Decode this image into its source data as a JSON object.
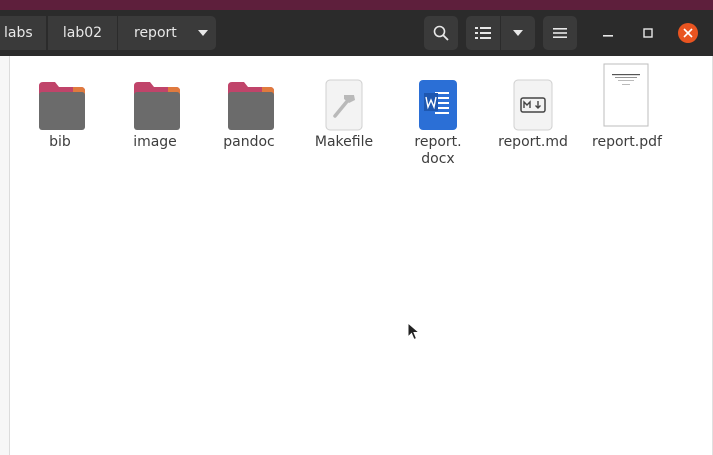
{
  "breadcrumbs": [
    "labs",
    "lab02",
    "report"
  ],
  "header": {
    "search_icon": "search-icon",
    "view_icon": "list-view-icon",
    "view_options_icon": "chevron-down-icon",
    "menu_icon": "hamburger-menu-icon"
  },
  "window_controls": [
    "minimize-icon",
    "maximize-icon",
    "close-icon"
  ],
  "files": [
    {
      "name": "bib",
      "type": "folder"
    },
    {
      "name": "image",
      "type": "folder"
    },
    {
      "name": "pandoc",
      "type": "folder"
    },
    {
      "name": "Makefile",
      "type": "makefile"
    },
    {
      "name": "report.\ndocx",
      "type": "docx"
    },
    {
      "name": "report.md",
      "type": "markdown"
    },
    {
      "name": "report.pdf",
      "type": "pdf"
    }
  ],
  "colors": {
    "accent_stripe": "#5e1f3c",
    "header": "#2b2b2b",
    "button": "#3a3a3a",
    "close": "#e95420",
    "folder": "#6b6b6b",
    "folder_tab": "#c0446a"
  }
}
